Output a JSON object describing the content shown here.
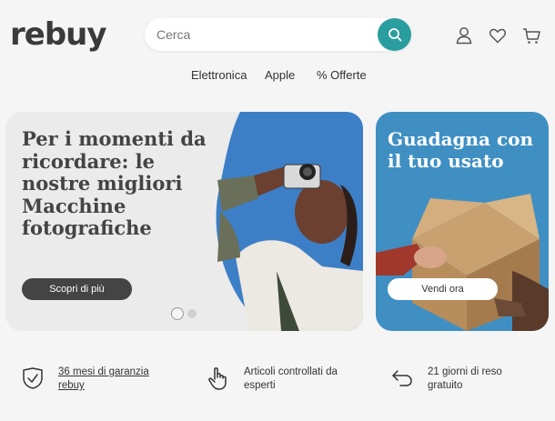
{
  "header": {
    "logo": "rebuy",
    "search_placeholder": "Cerca",
    "icons": [
      "search-icon",
      "user-icon",
      "heart-icon",
      "cart-icon"
    ]
  },
  "nav": {
    "items": [
      "Elettronica",
      "Apple",
      "% Offerte"
    ]
  },
  "hero": {
    "title": "Per i momenti da ricordare: le nostre migliori Macchine fotografiche",
    "button": "Scopri di più"
  },
  "sell": {
    "title": "Guadagna con il tuo usato",
    "button": "Vendi ora"
  },
  "features": [
    {
      "icon": "shield-check-icon",
      "text": "36 mesi di garanzia rebuy"
    },
    {
      "icon": "hand-pointer-icon",
      "text": "Articoli controllati da esperti"
    },
    {
      "icon": "return-arrow-icon",
      "text": "21 giorni di reso gratuito"
    }
  ],
  "colors": {
    "accent": "#2a9d9f",
    "sell_background": "#3f8fc3",
    "button_dark": "#444444"
  }
}
